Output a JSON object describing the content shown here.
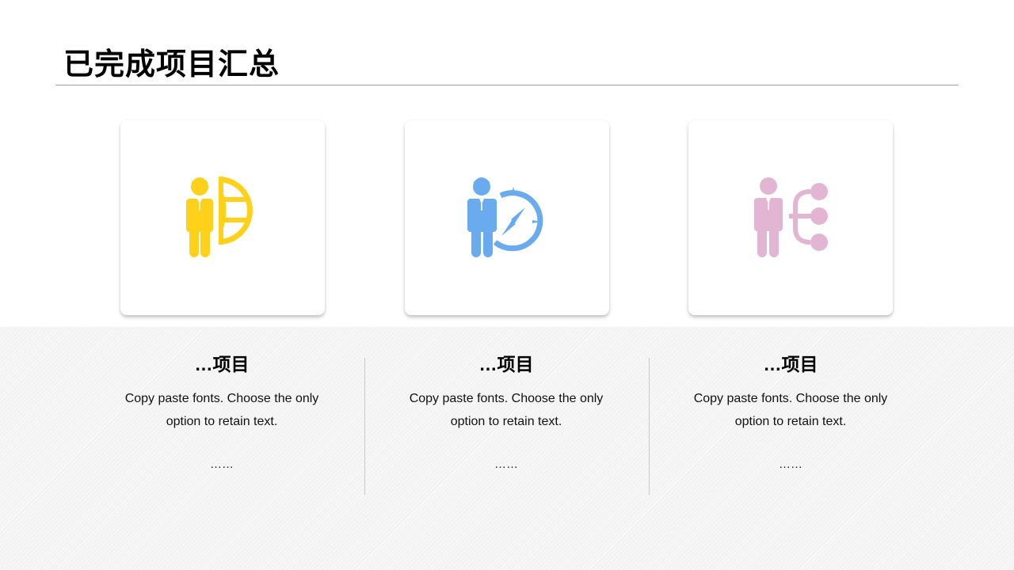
{
  "page": {
    "title": "已完成项目汇总"
  },
  "items": [
    {
      "icon": "businessman-globe-icon",
      "color": "#FFD11A",
      "title": "…项目",
      "description": "Copy paste fonts. Choose the only option to retain text.",
      "more": "……"
    },
    {
      "icon": "businessman-compass-icon",
      "color": "#6AABF0",
      "title": "…项目",
      "description": "Copy paste fonts. Choose the only option to retain text.",
      "more": "……"
    },
    {
      "icon": "businessman-flowchart-icon",
      "color": "#E2B6D2",
      "title": "…项目",
      "description": "Copy paste fonts. Choose the only option to retain text.",
      "more": "……"
    }
  ]
}
